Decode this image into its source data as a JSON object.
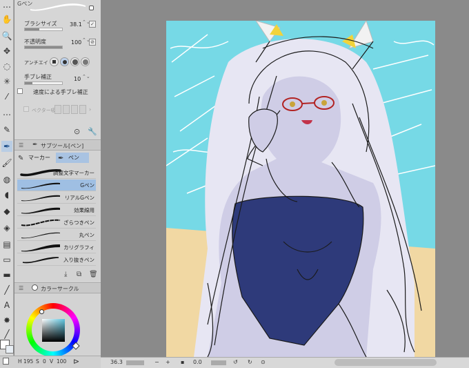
{
  "tool_property": {
    "brush_name": "Gペン",
    "brush_size_label": "ブラシサイズ",
    "brush_size_value": "38.1",
    "brush_size_level": 0.38,
    "opacity_label": "不透明度",
    "opacity_value": "100",
    "opacity_level": 1.0,
    "antialias_label": "アンチエイ",
    "stabilization_label": "手ブレ補正",
    "stabilization_value": "10",
    "stabilization_level": 0.2,
    "speed_stabilization_label": "速度による手ブレ補正",
    "vector_label": "ベクター吸"
  },
  "sub_tool": {
    "title": "サブツール[ペン]",
    "tabs": [
      {
        "label": "マーカー",
        "icon": "marker-icon"
      },
      {
        "label": "ペン",
        "icon": "pen-icon"
      }
    ],
    "brushes": [
      {
        "name": "調整文字マーカー",
        "active": false
      },
      {
        "name": "Gペン",
        "active": true
      },
      {
        "name": "リアルGペン",
        "active": false
      },
      {
        "name": "効果線用",
        "active": false
      },
      {
        "name": "ざらつきペン",
        "active": false
      },
      {
        "name": "丸ペン",
        "active": false
      },
      {
        "name": "カリグラフィ",
        "active": false
      },
      {
        "name": "入り抜きペン",
        "active": false
      }
    ]
  },
  "color_panel": {
    "title": "カラーサークル",
    "hue_color": "#5ec6e0",
    "h_label": "H",
    "h_value": "195",
    "s_label": "S",
    "s_value": "0",
    "v_label": "V",
    "v_value": "100"
  },
  "navigator": {
    "zoom_value": "36.3",
    "rotation_value": "0.0"
  },
  "colors": {
    "accent": "#9fbfe3",
    "canvas_background": "#76d9e6",
    "swimsuit": "#2e3a7a",
    "skin": "#cfcde6"
  }
}
